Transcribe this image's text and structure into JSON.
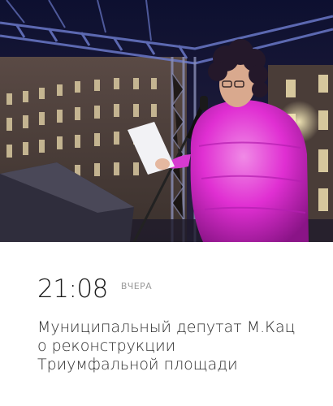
{
  "news_item": {
    "time": "21:08",
    "day_label": "ВЧЕРА",
    "headline_lines": [
      "Муниципальный депутат М.Кац",
      "о реконструкции",
      "Триумфальной площади"
    ],
    "photo_icon": "news-photo"
  },
  "colors": {
    "time_text": "#1a1a1a",
    "day_label_text": "#9a9a9a",
    "headline_text": "#2b2b2b",
    "jacket_magenta": "#e02fd2",
    "night_sky": "#161a3a"
  }
}
